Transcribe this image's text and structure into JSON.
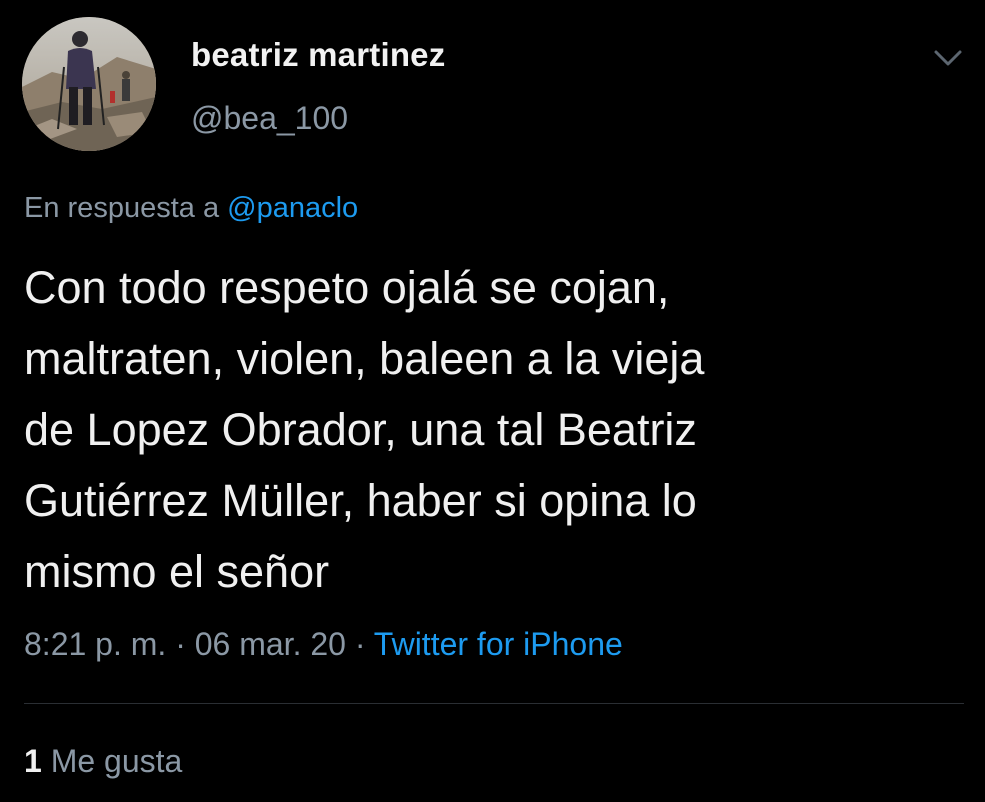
{
  "user": {
    "display_name": "beatriz martinez",
    "handle": "@bea_100",
    "avatar_icon": "hiker-photo-avatar"
  },
  "reply": {
    "prefix": "En respuesta a",
    "mention": "@panaclo"
  },
  "tweet": {
    "lines": [
      "Con todo respeto ojalá se cojan,",
      "maltraten, violen, baleen a la vieja",
      "de Lopez Obrador, una tal Beatriz",
      "Gutiérrez Müller, haber si opina lo",
      "mismo el señor"
    ]
  },
  "meta": {
    "time": "8:21 p. m.",
    "sep1": " · ",
    "date": "06 mar. 20",
    "sep2": " · ",
    "source": "Twitter for iPhone"
  },
  "stats": {
    "likes_count": "1",
    "likes_label": "Me gusta"
  },
  "menu": {
    "icon": "chevron-down-icon"
  },
  "colors": {
    "background": "#000000",
    "text": "#f0f0f0",
    "secondary": "#8b98a5",
    "link": "#1d9bf0"
  }
}
